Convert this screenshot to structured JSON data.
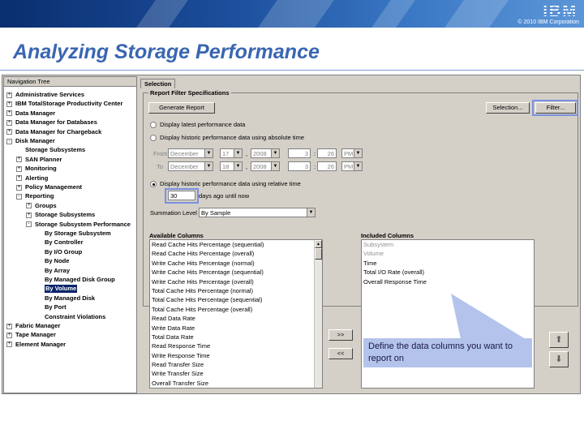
{
  "header": {
    "logo": "IBM",
    "copyright": "© 2010 IBM Corporation",
    "slide_title": "Analyzing Storage Performance"
  },
  "colors": {
    "banner": "#1c4f9c",
    "title": "#3a66b2",
    "callout": "#b3c3ec",
    "highlight": "#7b8fe0",
    "selection": "#0a246a"
  },
  "nav": {
    "header": "Navigation Tree",
    "items": [
      {
        "label": "Administrative Services",
        "expander": "+"
      },
      {
        "label": "IBM TotalStorage Productivity Center",
        "expander": "+"
      },
      {
        "label": "Data Manager",
        "expander": "+"
      },
      {
        "label": "Data Manager for Databases",
        "expander": "+"
      },
      {
        "label": "Data Manager for Chargeback",
        "expander": "+"
      },
      {
        "label": "Disk Manager",
        "expander": "-"
      },
      {
        "label": "Storage Subsystems",
        "expander": ""
      },
      {
        "label": "SAN Planner",
        "expander": "+"
      },
      {
        "label": "Monitoring",
        "expander": "+"
      },
      {
        "label": "Alerting",
        "expander": "+"
      },
      {
        "label": "Policy Management",
        "expander": "+"
      },
      {
        "label": "Reporting",
        "expander": "-"
      },
      {
        "label": "Groups",
        "expander": "+"
      },
      {
        "label": "Storage Subsystems",
        "expander": "+"
      },
      {
        "label": "Storage Subsystem Performance",
        "expander": "-"
      },
      {
        "label": "By Storage Subsystem",
        "expander": ""
      },
      {
        "label": "By Controller",
        "expander": ""
      },
      {
        "label": "By I/O Group",
        "expander": ""
      },
      {
        "label": "By Node",
        "expander": ""
      },
      {
        "label": "By Array",
        "expander": ""
      },
      {
        "label": "By Managed Disk Group",
        "expander": ""
      },
      {
        "label": "By Volume",
        "expander": ""
      },
      {
        "label": "By Managed Disk",
        "expander": ""
      },
      {
        "label": "By Port",
        "expander": ""
      },
      {
        "label": "Constraint Violations",
        "expander": ""
      },
      {
        "label": "Fabric Manager",
        "expander": "+"
      },
      {
        "label": "Tape Manager",
        "expander": "+"
      },
      {
        "label": "Element Manager",
        "expander": "+"
      }
    ]
  },
  "selection_tab": "Selection",
  "report_filter": {
    "title": "Report Filter Specifications",
    "generate_button": "Generate Report",
    "selection_button": "Selection...",
    "filter_button": "Filter...",
    "radio_latest": "Display latest performance data",
    "radio_absolute": "Display historic performance data using absolute time",
    "from_label": "From",
    "to_label": "To",
    "from": {
      "month": "December",
      "day": "17",
      "year": "2008",
      "hour": "3",
      "minute": "26",
      "ampm": "PM"
    },
    "to": {
      "month": "December",
      "day": "18",
      "year": "2008",
      "hour": "3",
      "minute": "26",
      "ampm": "PM"
    },
    "comma": ",",
    "colon": ":",
    "radio_relative": "Display historic performance data using relative time",
    "days_value": "30",
    "days_label": "days ago until now",
    "summation_label": "Summation Level",
    "summation_value": "By Sample"
  },
  "available_columns": {
    "title": "Available Columns",
    "items": [
      "Read Cache Hits Percentage (sequential)",
      "Read Cache Hits Percentage (overall)",
      "Write Cache Hits Percentage (normal)",
      "Write Cache Hits Percentage (sequential)",
      "Write Cache Hits Percentage (overall)",
      "Total Cache Hits Percentage (normal)",
      "Total Cache Hits Percentage (sequential)",
      "Total Cache Hits Percentage (overall)",
      "Read Data Rate",
      "Write Data Rate",
      "Total Data Rate",
      "Read Response Time",
      "Write Response Time",
      "Read Transfer Size",
      "Write Transfer Size",
      "Overall Transfer Size"
    ]
  },
  "included_columns": {
    "title": "Included Columns",
    "items": [
      {
        "label": "Subsystem",
        "dim": true
      },
      {
        "label": "Volume",
        "dim": true
      },
      {
        "label": "Time",
        "dim": false
      },
      {
        "label": "Total I/O Rate (overall)",
        "dim": false
      },
      {
        "label": "Overall Response Time",
        "dim": false
      }
    ]
  },
  "move_right_label": ">>",
  "move_left_label": "<<",
  "up_arrow": "⬆",
  "down_arrow": "⬇",
  "callout": "Define the data columns you want to report on"
}
